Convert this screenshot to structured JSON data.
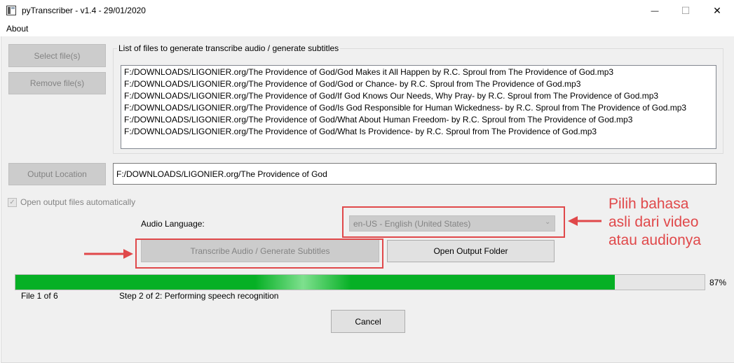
{
  "window": {
    "title": "pyTranscriber - v1.4 - 29/01/2020",
    "minimize_glyph": "—",
    "maximize_glyph": "☐",
    "close_glyph": "✕"
  },
  "menu": {
    "about_label": "About"
  },
  "buttons": {
    "select_files": "Select file(s)",
    "remove_files": "Remove file(s)",
    "output_location": "Output Location",
    "transcribe": "Transcribe Audio / Generate Subtitles",
    "open_output_folder": "Open Output Folder",
    "cancel": "Cancel"
  },
  "file_list": {
    "group_title": "List of files to generate transcribe audio / generate subtitles",
    "items": [
      "F:/DOWNLOADS/LIGONIER.org/The Providence of God/God Makes it All Happen by R.C. Sproul from The Providence of God.mp3",
      "F:/DOWNLOADS/LIGONIER.org/The Providence of God/God or Chance- by R.C. Sproul from The Providence of God.mp3",
      "F:/DOWNLOADS/LIGONIER.org/The Providence of God/If God Knows Our Needs, Why Pray- by R.C. Sproul from The Providence of God.mp3",
      "F:/DOWNLOADS/LIGONIER.org/The Providence of God/Is God Responsible for Human Wickedness- by R.C. Sproul from The Providence of God.mp3",
      "F:/DOWNLOADS/LIGONIER.org/The Providence of God/What About Human Freedom- by R.C. Sproul from The Providence of God.mp3",
      "F:/DOWNLOADS/LIGONIER.org/The Providence of God/What Is Providence- by R.C. Sproul from The Providence of God.mp3"
    ]
  },
  "output": {
    "path": "F:/DOWNLOADS/LIGONIER.org/The Providence of God"
  },
  "options": {
    "open_output_label": "Open output files automatically",
    "open_output_checked": true,
    "check_glyph": "✓"
  },
  "language": {
    "label": "Audio Language:",
    "selected": "en-US - English (United States)",
    "arrow_glyph": "⌄"
  },
  "progress": {
    "value": 0.87,
    "percent_label": "87%",
    "file_label": "File 1 of 6",
    "step_label": "Step 2 of 2: Performing speech recognition"
  },
  "annotation": {
    "lines": [
      "Pilih bahasa",
      "asli dari video",
      "atau audionya"
    ],
    "color": "#e0484a"
  },
  "colors": {
    "progress_green": "#06b025",
    "annotation_red": "#e0484a"
  }
}
